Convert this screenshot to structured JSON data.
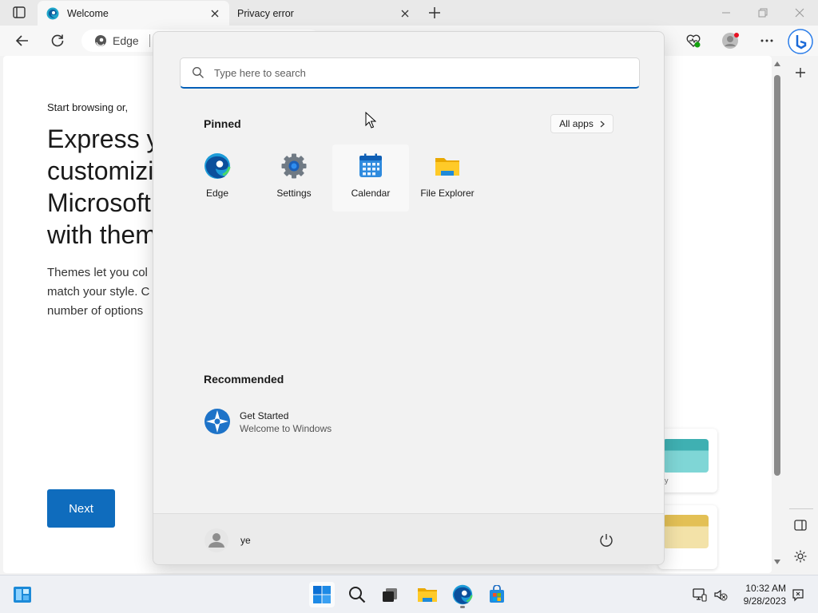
{
  "browser": {
    "tabs": [
      {
        "title": "Welcome",
        "active": true
      },
      {
        "title": "Privacy error",
        "active": false
      }
    ],
    "address_label": "Edge"
  },
  "page": {
    "intro": "Start browsing or,",
    "title": "Express y customizi Microsoft with them",
    "title_lines": [
      "Express y",
      "customizi",
      "Microsoft",
      "with them"
    ],
    "description_lines": [
      "Themes let you col",
      "match your style. C",
      "number of options"
    ],
    "next_label": "Next",
    "card_label": "y"
  },
  "start_menu": {
    "search_placeholder": "Type here to search",
    "pinned_title": "Pinned",
    "all_apps_label": "All apps",
    "pinned": [
      {
        "label": "Edge",
        "icon": "edge-icon"
      },
      {
        "label": "Settings",
        "icon": "settings-gear-icon"
      },
      {
        "label": "Calendar",
        "icon": "calendar-icon"
      },
      {
        "label": "File Explorer",
        "icon": "folder-icon"
      }
    ],
    "recommended_title": "Recommended",
    "recommended": [
      {
        "title": "Get Started",
        "subtitle": "Welcome to Windows",
        "icon": "get-started-icon"
      }
    ],
    "user_name": "ye"
  },
  "taskbar": {
    "time": "10:32 AM",
    "date": "9/28/2023"
  },
  "colors": {
    "accent": "#0f6cbd",
    "search_underline": "#005fb8"
  }
}
